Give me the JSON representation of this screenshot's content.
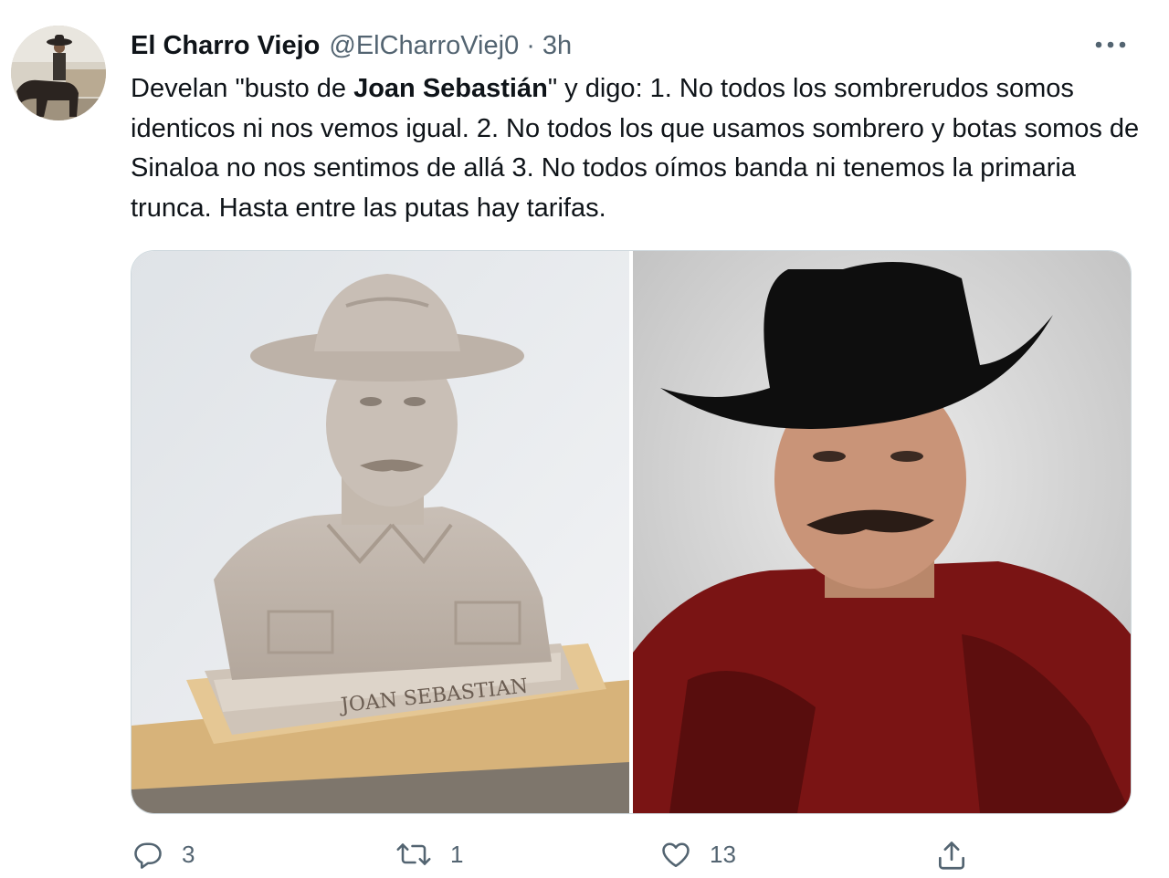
{
  "tweet": {
    "display_name": "El Charro Viejo",
    "handle": "@ElCharroViej0",
    "separator": "·",
    "time": "3h",
    "text_parts": {
      "p1": "Develan \"busto de ",
      "p2_bold": "Joan Sebastián",
      "p3": "\" y digo: 1. No todos los sombrerudos somos identicos ni nos vemos igual. 2. No todos los que usamos sombrero y botas somos de Sinaloa no nos sentimos de allá 3. No todos oímos banda ni tenemos la primaria trunca. Hasta entre las putas hay tarifas."
    },
    "bust_plaque_text": "JOAN SEBASTIAN",
    "media": [
      {
        "icon": "bust-photo"
      },
      {
        "icon": "portrait-photo"
      }
    ],
    "actions": {
      "reply_count": "3",
      "retweet_count": "1",
      "like_count": "13"
    }
  },
  "colors": {
    "text": "#0f1419",
    "secondary": "#536471",
    "border": "#cfd9de"
  }
}
